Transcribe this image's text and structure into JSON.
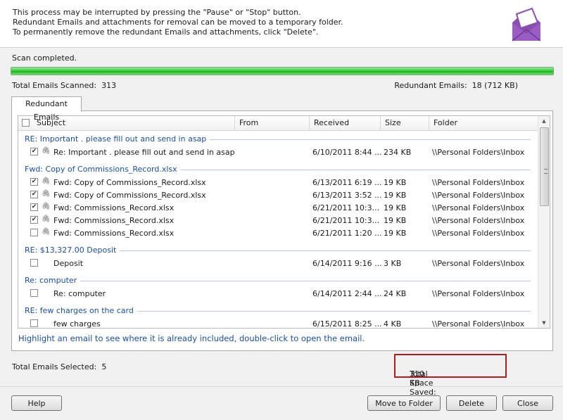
{
  "header": {
    "lines": [
      "This process may be interrupted by pressing the \"Pause\" or \"Stop\" button.",
      "Redundant Emails and attachments for removal can be moved to a temporary folder.",
      "To permanently remove the redundant Emails and attachments, click \"Delete\"."
    ],
    "logo_icon": "envelope-logo-icon",
    "brand_color": "#8a4fb3"
  },
  "scan": {
    "status": "Scan completed.",
    "progress_percent": 100,
    "bar_color": "#2fc42f"
  },
  "stats": {
    "scanned_label": "Total Emails Scanned:",
    "scanned_value": "313",
    "redundant_label": "Redundant Emails:",
    "redundant_value": "18 (712 KB)"
  },
  "tab": {
    "label": "Redundant Emails"
  },
  "grid": {
    "columns": [
      "Subject",
      "From",
      "Received",
      "Size",
      "Folder"
    ],
    "groups": [
      {
        "title": "RE: Important . please fill out and send in asap",
        "rows": [
          {
            "checked": true,
            "attachment": true,
            "subject": "Re: Important . please fill out and send in asap",
            "from": "",
            "received": "6/10/2011 8:44 ...",
            "size": "234 KB",
            "folder": "\\\\Personal Folders\\Inbox"
          }
        ]
      },
      {
        "title": "Fwd: Copy of Commissions_Record.xlsx",
        "rows": [
          {
            "checked": true,
            "attachment": true,
            "subject": "Fwd: Copy of Commissions_Record.xlsx",
            "from": "",
            "received": "6/13/2011 6:19 ...",
            "size": "19 KB",
            "folder": "\\\\Personal Folders\\Inbox"
          },
          {
            "checked": true,
            "attachment": true,
            "subject": "Fwd: Copy of Commissions_Record.xlsx",
            "from": "",
            "received": "6/13/2011 3:52 ...",
            "size": "19 KB",
            "folder": "\\\\Personal Folders\\Inbox"
          },
          {
            "checked": true,
            "attachment": true,
            "subject": "Fwd: Commissions_Record.xlsx",
            "from": "",
            "received": "6/21/2011 10:3...",
            "size": "19 KB",
            "folder": "\\\\Personal Folders\\Inbox"
          },
          {
            "checked": true,
            "attachment": true,
            "subject": "Fwd: Commissions_Record.xlsx",
            "from": "",
            "received": "6/21/2011 10:3...",
            "size": "19 KB",
            "folder": "\\\\Personal Folders\\Inbox"
          },
          {
            "checked": false,
            "attachment": true,
            "subject": "Fwd: Commissions_Record.xlsx",
            "from": "",
            "received": "6/21/2011 1:20 ...",
            "size": "19 KB",
            "folder": "\\\\Personal Folders\\Inbox"
          }
        ]
      },
      {
        "title": "RE: $13,327.00 Deposit",
        "rows": [
          {
            "checked": false,
            "attachment": false,
            "subject": "Deposit",
            "from": "",
            "received": "6/14/2011 9:16 ...",
            "size": "3 KB",
            "folder": "\\\\Personal Folders\\Inbox"
          }
        ]
      },
      {
        "title": "Re: computer",
        "rows": [
          {
            "checked": false,
            "attachment": false,
            "subject": "Re: computer",
            "from": "",
            "received": "6/14/2011 2:44 ...",
            "size": "24 KB",
            "folder": "\\\\Personal Folders\\Inbox"
          }
        ]
      },
      {
        "title": "RE: few charges on the card",
        "rows": [
          {
            "checked": false,
            "attachment": false,
            "subject": "few charges",
            "from": "",
            "received": "6/15/2011 8:25 ...",
            "size": "4 KB",
            "folder": "\\\\Personal Folders\\Inbox"
          }
        ]
      }
    ]
  },
  "hint": "Highlight an email to see where it is already included, double-click to open the email.",
  "summary": {
    "selected_label": "Total Emails Selected:",
    "selected_value": "5",
    "space_label": "Total Space Saved:",
    "space_value": "310 KB",
    "highlight_color": "#b01b1b"
  },
  "buttons": {
    "help": "Help",
    "move": "Move to Folder",
    "delete": "Delete",
    "close": "Close"
  }
}
